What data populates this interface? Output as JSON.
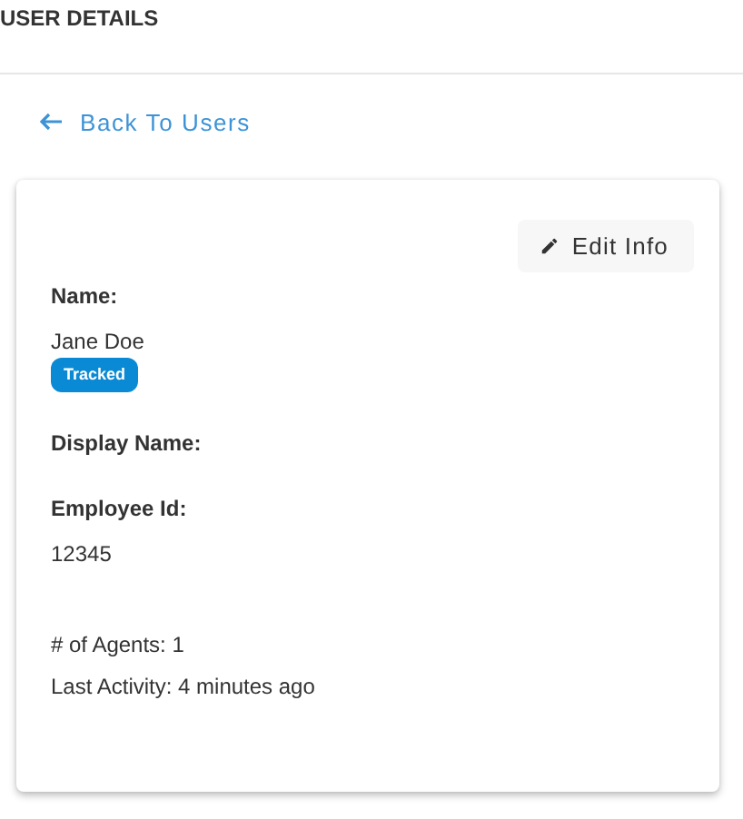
{
  "header": {
    "title": "USER DETAILS"
  },
  "back_link": {
    "label": "Back To Users"
  },
  "card": {
    "edit_button": {
      "label": "Edit Info"
    },
    "fields": [
      {
        "label": "Name:",
        "value": "Jane Doe",
        "badge": "Tracked"
      },
      {
        "label": "Display Name:"
      },
      {
        "label": "Employee Id:",
        "value": "12345"
      }
    ],
    "stats": [
      "# of Agents: 1",
      "Last Activity: 4 minutes ago"
    ]
  }
}
